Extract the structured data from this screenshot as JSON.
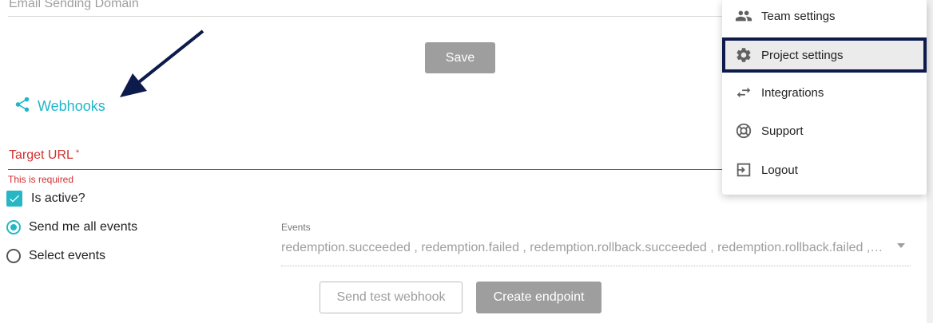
{
  "form": {
    "email_label": "Email Sending Domain",
    "save_label": "Save"
  },
  "webhooks": {
    "title": "Webhooks",
    "target_label": "Target URL",
    "required_mark": "*",
    "error_text": "This is required",
    "is_active_label": "Is active?",
    "is_active_checked": true,
    "radio_all_label": "Send me all events",
    "radio_select_label": "Select events",
    "selected_radio": "all",
    "events_label": "Events",
    "events_value": "redemption.succeeded , redemption.failed , redemption.rollback.succeeded , redemption.rollback.failed ,…",
    "test_button": "Send test webhook",
    "create_button": "Create endpoint"
  },
  "menu": {
    "items": [
      {
        "label": "Team settings",
        "icon": "people-icon"
      },
      {
        "label": "Project settings",
        "icon": "gear-icon",
        "active": true
      },
      {
        "label": "Integrations",
        "icon": "swap-arrows-icon"
      },
      {
        "label": "Support",
        "icon": "lifebuoy-icon"
      },
      {
        "label": "Logout",
        "icon": "logout-icon"
      }
    ]
  },
  "colors": {
    "accent": "#26b6c5",
    "error": "#d32f2f",
    "highlight_border": "#0d1b4c",
    "button_disabled": "#9e9e9e"
  }
}
